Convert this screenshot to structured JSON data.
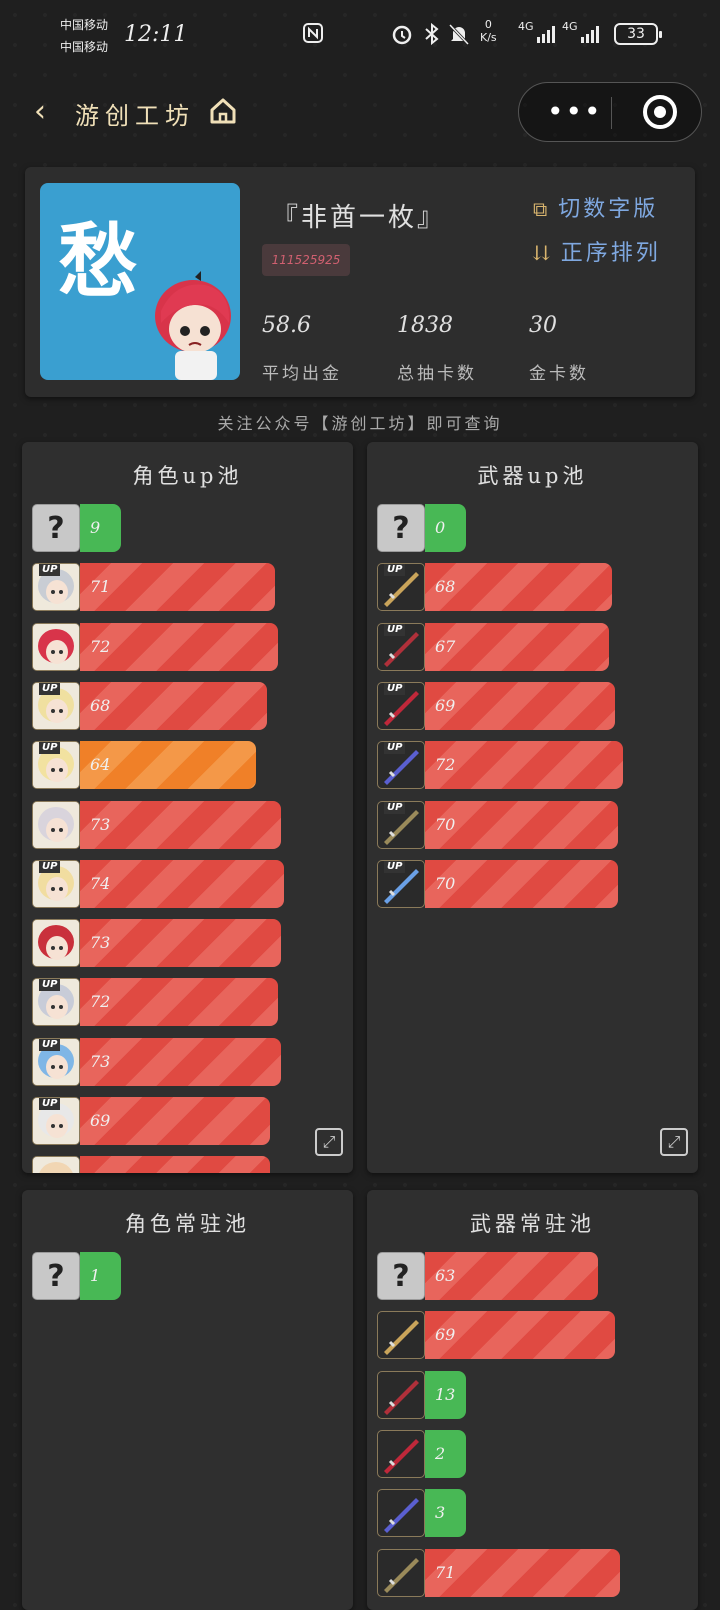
{
  "status": {
    "carrier1": "中国移动",
    "carrier2": "中国移动",
    "time": "12:11",
    "net_speed_top": "0",
    "net_speed_unit": "K/s",
    "net1": "4G",
    "net2": "4G",
    "battery": "33"
  },
  "nav": {
    "back": "‹",
    "title": "游创工坊"
  },
  "profile": {
    "avatar_text": "愁",
    "nickname": "『非酋一枚』",
    "uid": "111525925",
    "switch_label": "切数字版",
    "sort_label": "正序排列",
    "stats": [
      {
        "value": "58.6",
        "label": "平均出金"
      },
      {
        "value": "1838",
        "label": "总抽卡数"
      },
      {
        "value": "30",
        "label": "金卡数"
      }
    ]
  },
  "notice": "关注公众号【游创工坊】即可查询",
  "pools": {
    "char_up": {
      "title": "角色up池",
      "rows": [
        {
          "kind": "unknown",
          "value": "9",
          "color": "green",
          "pct": 0.15
        },
        {
          "kind": "char",
          "up": true,
          "value": "71",
          "color": "red",
          "pct": 0.71
        },
        {
          "kind": "char",
          "up": false,
          "value": "72",
          "color": "red",
          "pct": 0.72
        },
        {
          "kind": "char",
          "up": true,
          "value": "68",
          "color": "red",
          "pct": 0.68
        },
        {
          "kind": "char",
          "up": true,
          "value": "64",
          "color": "orange",
          "pct": 0.64
        },
        {
          "kind": "char",
          "up": false,
          "value": "73",
          "color": "red",
          "pct": 0.73
        },
        {
          "kind": "char",
          "up": true,
          "value": "74",
          "color": "red",
          "pct": 0.74
        },
        {
          "kind": "char",
          "up": false,
          "value": "73",
          "color": "red",
          "pct": 0.73
        },
        {
          "kind": "char",
          "up": true,
          "value": "72",
          "color": "red",
          "pct": 0.72
        },
        {
          "kind": "char",
          "up": true,
          "value": "73",
          "color": "red",
          "pct": 0.73
        },
        {
          "kind": "char",
          "up": true,
          "value": "69",
          "color": "red",
          "pct": 0.69
        },
        {
          "kind": "char",
          "up": false,
          "value": "",
          "color": "red",
          "pct": 0.69
        }
      ]
    },
    "weapon_up": {
      "title": "武器up池",
      "rows": [
        {
          "kind": "unknown",
          "value": "0",
          "color": "green",
          "pct": 0.15
        },
        {
          "kind": "weapon",
          "up": true,
          "value": "68",
          "color": "red",
          "pct": 0.68
        },
        {
          "kind": "weapon",
          "up": true,
          "value": "67",
          "color": "red",
          "pct": 0.67
        },
        {
          "kind": "weapon",
          "up": true,
          "value": "69",
          "color": "red",
          "pct": 0.69
        },
        {
          "kind": "weapon",
          "up": true,
          "value": "72",
          "color": "red",
          "pct": 0.72
        },
        {
          "kind": "weapon",
          "up": true,
          "value": "70",
          "color": "red",
          "pct": 0.7
        },
        {
          "kind": "weapon",
          "up": true,
          "value": "70",
          "color": "red",
          "pct": 0.7
        }
      ]
    },
    "char_std": {
      "title": "角色常驻池",
      "rows": [
        {
          "kind": "unknown",
          "value": "1",
          "color": "green",
          "pct": 0.15
        }
      ]
    },
    "weapon_std": {
      "title": "武器常驻池",
      "rows": [
        {
          "kind": "unknown",
          "value": "63",
          "color": "red",
          "pct": 0.63
        },
        {
          "kind": "weapon",
          "up": false,
          "value": "69",
          "color": "red",
          "pct": 0.69
        },
        {
          "kind": "weapon",
          "up": false,
          "value": "13",
          "color": "green",
          "pct": 0.15
        },
        {
          "kind": "weapon",
          "up": false,
          "value": "2",
          "color": "green",
          "pct": 0.15
        },
        {
          "kind": "weapon",
          "up": false,
          "value": "3",
          "color": "green",
          "pct": 0.15
        },
        {
          "kind": "weapon",
          "up": false,
          "value": "71",
          "color": "red",
          "pct": 0.71
        }
      ]
    }
  }
}
